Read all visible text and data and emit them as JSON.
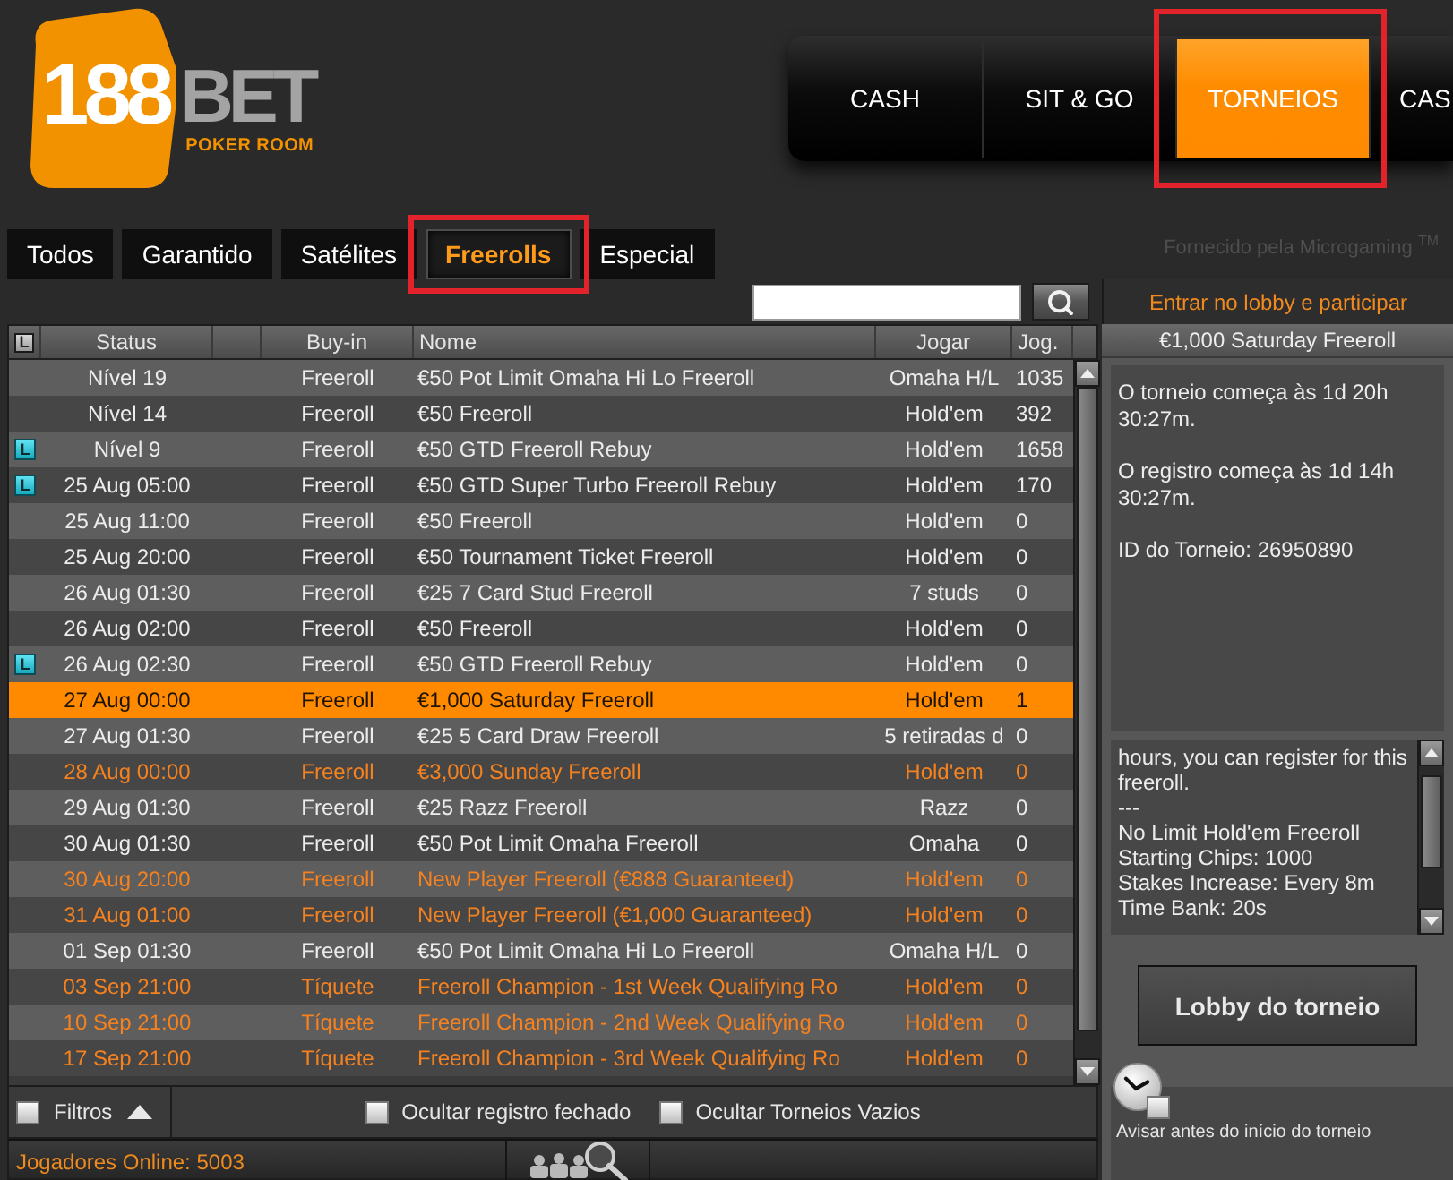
{
  "logo": {
    "number": "188",
    "word": "BET",
    "tagline": "POKER ROOM"
  },
  "nav": [
    {
      "label": "CASH",
      "selected": false,
      "highlighted": false
    },
    {
      "label": "SIT & GO",
      "selected": false,
      "highlighted": false
    },
    {
      "label": "TORNEIOS",
      "selected": true,
      "highlighted": true
    },
    {
      "label": "CAS",
      "selected": false,
      "highlighted": false
    }
  ],
  "tabs": [
    {
      "label": "Todos",
      "selected": false,
      "highlighted": false
    },
    {
      "label": "Garantido",
      "selected": false,
      "highlighted": false
    },
    {
      "label": "Satélites",
      "selected": false,
      "highlighted": false
    },
    {
      "label": "Freerolls",
      "selected": true,
      "highlighted": true
    },
    {
      "label": "Especial",
      "selected": false,
      "highlighted": false
    }
  ],
  "provider_note": "Fornecido pela Microgaming $^{TM}$",
  "lobby_link": "Entrar no lobby e participar",
  "table": {
    "columns": [
      {
        "kind": "tag",
        "label": "L"
      },
      {
        "kind": "text",
        "label": "Status"
      },
      {
        "kind": "spacer"
      },
      {
        "kind": "text",
        "label": "Buy-in"
      },
      {
        "kind": "text",
        "label": "Nome"
      },
      {
        "kind": "text",
        "label": "Jogar"
      },
      {
        "kind": "text",
        "label": "Jog."
      }
    ],
    "rows": [
      {
        "status": "Nível 19",
        "buy_in": "Freeroll",
        "name": "€50 Pot Limit Omaha Hi Lo Freeroll",
        "game": "Omaha H/L",
        "players": "1035",
        "selected": false,
        "featured": false
      },
      {
        "status": "Nível 14",
        "buy_in": "Freeroll",
        "name": "€50 Freeroll",
        "game": "Hold'em",
        "players": "392",
        "selected": false,
        "featured": false
      },
      {
        "badge": "L",
        "status": "Nível 9",
        "buy_in": "Freeroll",
        "name": "€50 GTD Freeroll Rebuy",
        "game": "Hold'em",
        "players": "1658",
        "selected": false,
        "featured": false
      },
      {
        "badge": "L",
        "status": "25 Aug 05:00",
        "buy_in": "Freeroll",
        "name": "€50 GTD Super Turbo Freeroll Rebuy",
        "game": "Hold'em",
        "players": "170",
        "selected": false,
        "featured": false
      },
      {
        "status": "25 Aug 11:00",
        "buy_in": "Freeroll",
        "name": "€50 Freeroll",
        "game": "Hold'em",
        "players": "0",
        "selected": false,
        "featured": false
      },
      {
        "status": "25 Aug 20:00",
        "buy_in": "Freeroll",
        "name": "€50 Tournament Ticket Freeroll",
        "game": "Hold'em",
        "players": "0",
        "selected": false,
        "featured": false
      },
      {
        "status": "26 Aug 01:30",
        "buy_in": "Freeroll",
        "name": "€25 7 Card Stud Freeroll",
        "game": "7 studs",
        "players": "0",
        "selected": false,
        "featured": false
      },
      {
        "status": "26 Aug 02:00",
        "buy_in": "Freeroll",
        "name": "€50 Freeroll",
        "game": "Hold'em",
        "players": "0",
        "selected": false,
        "featured": false
      },
      {
        "badge": "L",
        "status": "26 Aug 02:30",
        "buy_in": "Freeroll",
        "name": "€50 GTD Freeroll Rebuy",
        "game": "Hold'em",
        "players": "0",
        "selected": false,
        "featured": false
      },
      {
        "status": "27 Aug 00:00",
        "buy_in": "Freeroll",
        "name": "€1,000 Saturday Freeroll",
        "game": "Hold'em",
        "players": "1",
        "selected": true,
        "featured": false
      },
      {
        "status": "27 Aug 01:30",
        "buy_in": "Freeroll",
        "name": "€25 5 Card Draw Freeroll",
        "game": "5 retiradas d",
        "players": "0",
        "selected": false,
        "featured": false
      },
      {
        "status": "28 Aug 00:00",
        "buy_in": "Freeroll",
        "name": "€3,000 Sunday Freeroll",
        "game": "Hold'em",
        "players": "0",
        "selected": false,
        "featured": true
      },
      {
        "status": "29 Aug 01:30",
        "buy_in": "Freeroll",
        "name": "€25 Razz Freeroll",
        "game": "Razz",
        "players": "0",
        "selected": false,
        "featured": false
      },
      {
        "status": "30 Aug 01:30",
        "buy_in": "Freeroll",
        "name": "€50 Pot Limit Omaha Freeroll",
        "game": "Omaha",
        "players": "0",
        "selected": false,
        "featured": false
      },
      {
        "status": "30 Aug 20:00",
        "buy_in": "Freeroll",
        "name": "New Player Freeroll (€888 Guaranteed)",
        "game": "Hold'em",
        "players": "0",
        "selected": false,
        "featured": true
      },
      {
        "status": "31 Aug 01:00",
        "buy_in": "Freeroll",
        "name": "New Player Freeroll (€1,000 Guaranteed)",
        "game": "Hold'em",
        "players": "0",
        "selected": false,
        "featured": true
      },
      {
        "status": "01 Sep 01:30",
        "buy_in": "Freeroll",
        "name": "€50 Pot Limit Omaha Hi Lo Freeroll",
        "game": "Omaha H/L",
        "players": "0",
        "selected": false,
        "featured": false
      },
      {
        "status": "03 Sep 21:00",
        "buy_in": "Tíquete",
        "name": "Freeroll Champion - 1st Week Qualifying Ro",
        "game": "Hold'em",
        "players": "0",
        "selected": false,
        "featured": true
      },
      {
        "status": "10 Sep 21:00",
        "buy_in": "Tíquete",
        "name": "Freeroll Champion - 2nd Week Qualifying Ro",
        "game": "Hold'em",
        "players": "0",
        "selected": false,
        "featured": true
      },
      {
        "status": "17 Sep 21:00",
        "buy_in": "Tíquete",
        "name": "Freeroll Champion - 3rd Week Qualifying Ro",
        "game": "Hold'em",
        "players": "0",
        "selected": false,
        "featured": true
      }
    ]
  },
  "filters": {
    "toggle": {
      "label": "Filtros",
      "checked": false
    },
    "options": [
      {
        "label": "Ocultar registro fechado",
        "checked": false
      },
      {
        "label": "Ocultar Torneios Vazios",
        "checked": false
      }
    ]
  },
  "status_bar": {
    "players_online": "Jogadores Online: 5003"
  },
  "details": {
    "title": "€1,000 Saturday Freeroll",
    "info": [
      "O torneio começa às 1d 20h 30:27m.",
      "O registro começa às 1d 14h 30:27m.",
      "ID do Torneio: 26950890"
    ],
    "description": [
      "hours, you can register for this freeroll.",
      "---",
      "No Limit Hold'em Freeroll",
      "Starting Chips: 1000",
      "Stakes Increase: Every 8m",
      "Time Bank: 20s"
    ],
    "lobby_button": "Lobby do torneio",
    "reminder": {
      "label": "Avisar antes do início do torneio",
      "checked": false
    }
  }
}
